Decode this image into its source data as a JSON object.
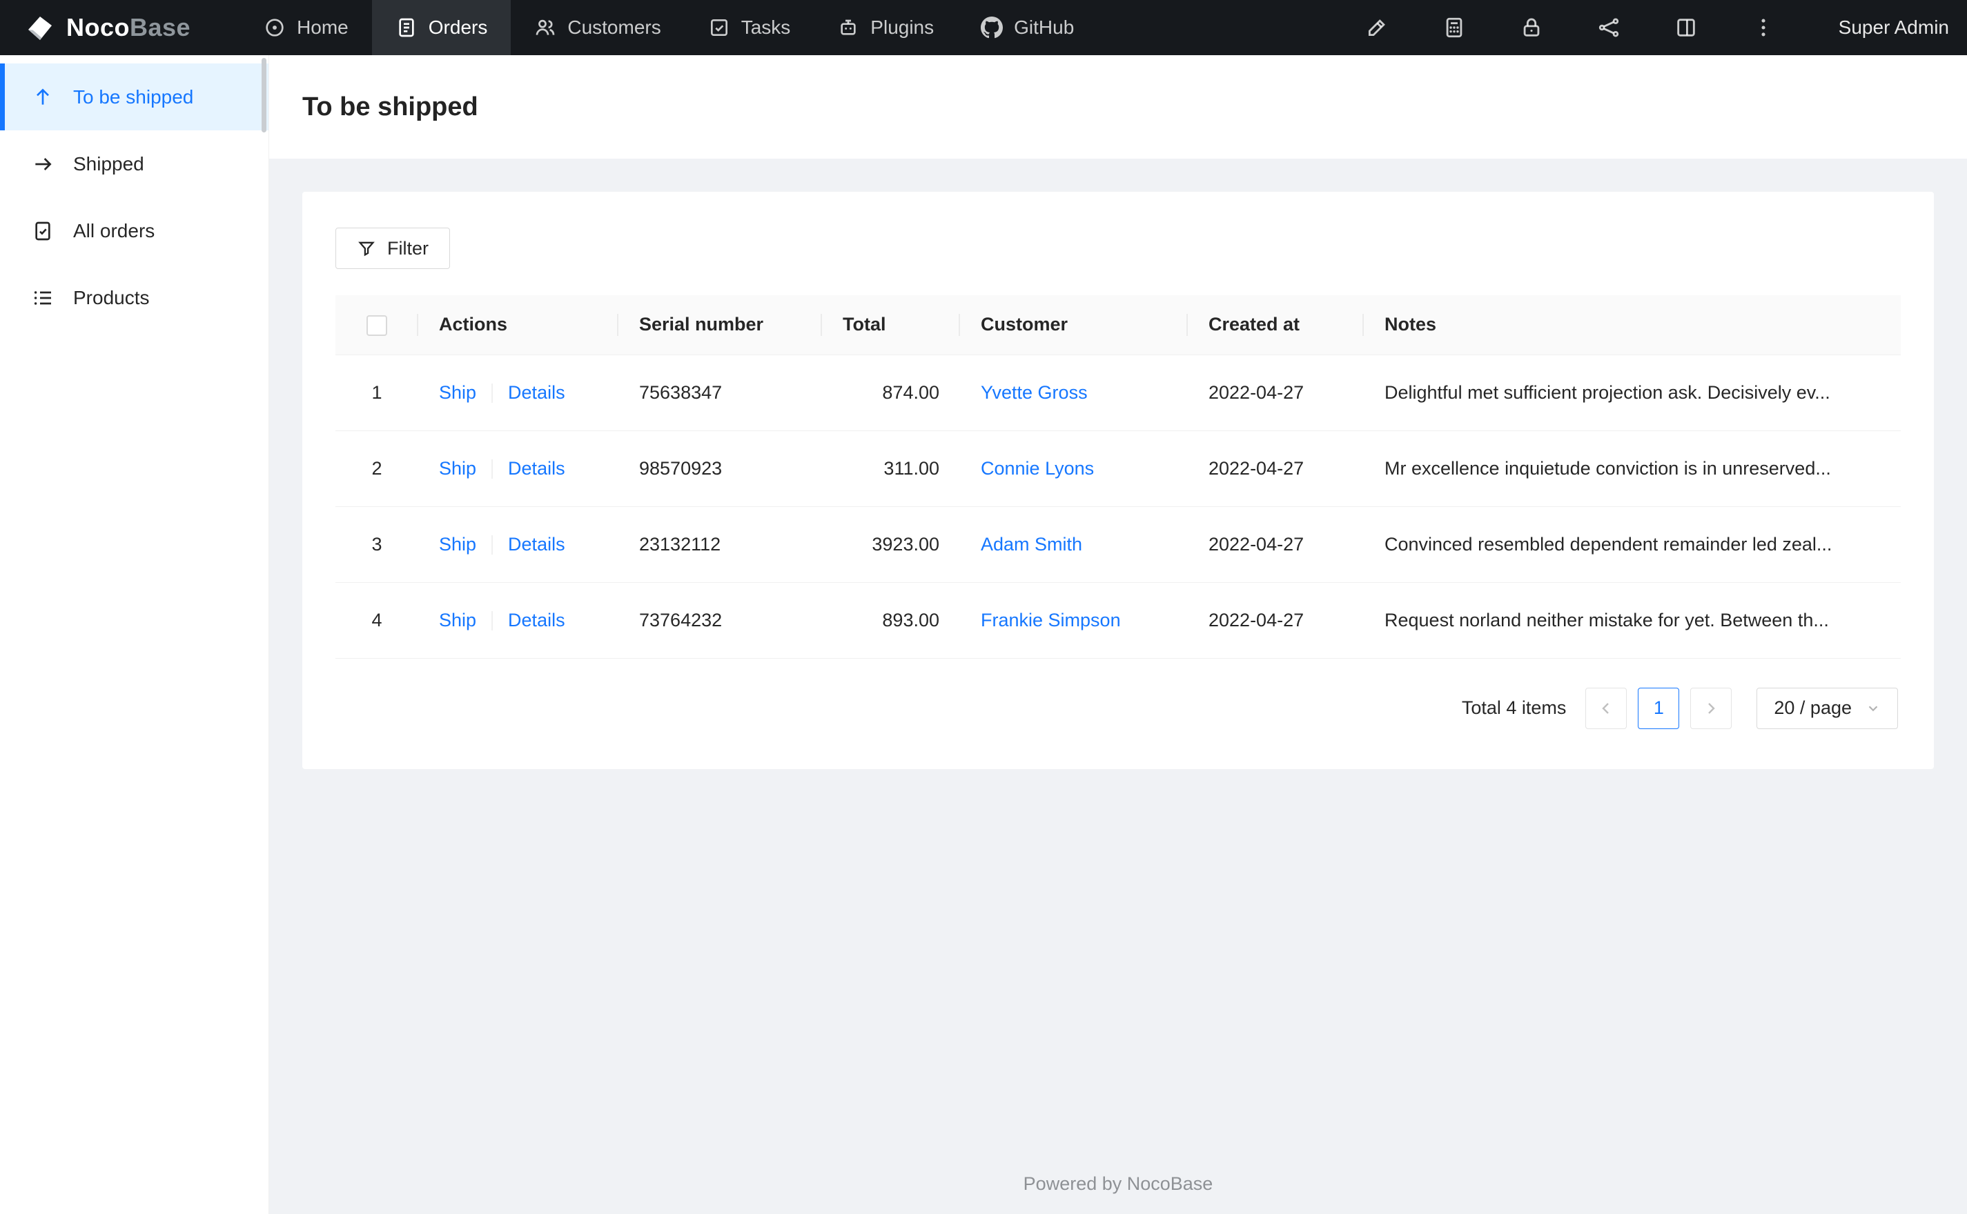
{
  "topbar": {
    "logo_primary": "Noco",
    "logo_secondary": "Base",
    "nav": [
      {
        "label": "Home"
      },
      {
        "label": "Orders"
      },
      {
        "label": "Customers"
      },
      {
        "label": "Tasks"
      },
      {
        "label": "Plugins"
      },
      {
        "label": "GitHub"
      }
    ],
    "user": "Super Admin"
  },
  "sidebar": {
    "items": [
      {
        "label": "To be shipped"
      },
      {
        "label": "Shipped"
      },
      {
        "label": "All orders"
      },
      {
        "label": "Products"
      }
    ]
  },
  "page": {
    "title": "To be shipped"
  },
  "toolbar": {
    "filter_label": "Filter"
  },
  "table": {
    "columns": {
      "actions": "Actions",
      "serial": "Serial number",
      "total": "Total",
      "customer": "Customer",
      "created_at": "Created at",
      "notes": "Notes"
    },
    "rows": [
      {
        "index": "1",
        "action_ship": "Ship",
        "action_details": "Details",
        "serial": "75638347",
        "total": "874.00",
        "customer": "Yvette Gross",
        "created_at": "2022-04-27",
        "notes": "Delightful met sufficient projection ask. Decisively ev..."
      },
      {
        "index": "2",
        "action_ship": "Ship",
        "action_details": "Details",
        "serial": "98570923",
        "total": "311.00",
        "customer": "Connie Lyons",
        "created_at": "2022-04-27",
        "notes": "Mr excellence inquietude conviction is in unreserved..."
      },
      {
        "index": "3",
        "action_ship": "Ship",
        "action_details": "Details",
        "serial": "23132112",
        "total": "3923.00",
        "customer": "Adam Smith",
        "created_at": "2022-04-27",
        "notes": "Convinced resembled dependent remainder led zeal..."
      },
      {
        "index": "4",
        "action_ship": "Ship",
        "action_details": "Details",
        "serial": "73764232",
        "total": "893.00",
        "customer": "Frankie Simpson",
        "created_at": "2022-04-27",
        "notes": "Request norland neither mistake for yet. Between th..."
      }
    ]
  },
  "pagination": {
    "total_label": "Total 4 items",
    "current_page": "1",
    "page_size": "20 / page"
  },
  "footer": {
    "text": "Powered by NocoBase"
  },
  "colors": {
    "accent": "#1677ff",
    "topbar_bg": "#16191d",
    "active_nav_bg": "#2c3035",
    "sidebar_active_bg": "#e6f4ff",
    "page_bg": "#f0f2f5"
  }
}
